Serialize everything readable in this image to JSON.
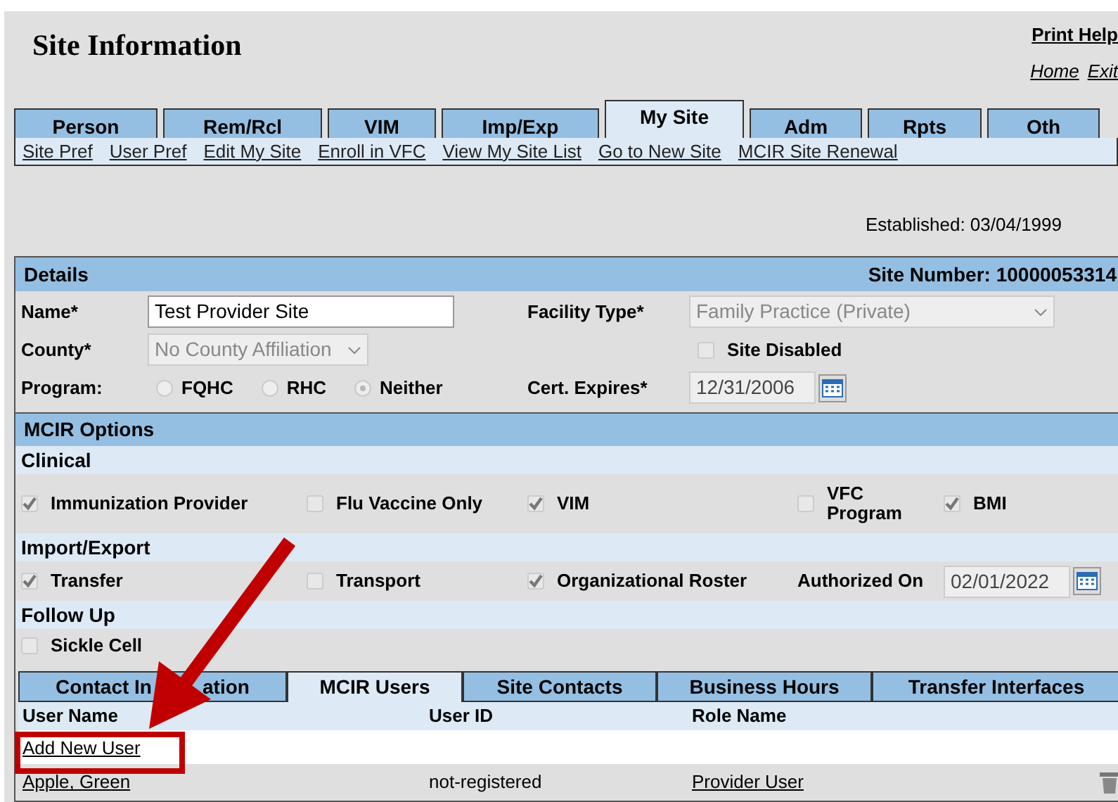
{
  "header": {
    "title": "Site Information",
    "print_help": "Print Help",
    "links": [
      "Home",
      "Exit"
    ]
  },
  "tabs": [
    {
      "label": "Person",
      "selected": false
    },
    {
      "label": "Rem/Rcl",
      "selected": false
    },
    {
      "label": "VIM",
      "selected": false
    },
    {
      "label": "Imp/Exp",
      "selected": false
    },
    {
      "label": "My Site",
      "selected": true
    },
    {
      "label": "Adm",
      "selected": false
    },
    {
      "label": "Rpts",
      "selected": false
    },
    {
      "label": "Oth",
      "selected": false
    }
  ],
  "subnav": [
    "Site Pref",
    "User Pref",
    "Edit My Site",
    "Enroll in VFC",
    "View My Site List",
    "Go to New Site",
    "MCIR Site Renewal"
  ],
  "established": "Established: 03/04/1999",
  "details": {
    "title": "Details",
    "site_number": "Site Number: 10000053314",
    "name": {
      "label": "Name*",
      "value": "Test Provider Site"
    },
    "facility_type": {
      "label": "Facility Type*",
      "value": "Family Practice (Private)",
      "disabled": true
    },
    "county": {
      "label": "County*",
      "value": "No County Affiliation",
      "disabled": true
    },
    "site_disabled": {
      "label": "Site Disabled",
      "checked": false
    },
    "program": {
      "label": "Program:",
      "options": [
        {
          "label": "FQHC",
          "selected": false
        },
        {
          "label": "RHC",
          "selected": false
        },
        {
          "label": "Neither",
          "selected": true
        }
      ]
    },
    "cert_expires": {
      "label": "Cert. Expires*",
      "value": "12/31/2006"
    }
  },
  "mcir_options": {
    "title": "MCIR Options",
    "groups": [
      {
        "title": "Clinical",
        "options": [
          {
            "label": "Immunization Provider",
            "checked": true
          },
          {
            "label": "Flu Vaccine Only",
            "checked": false
          },
          {
            "label": "VIM",
            "checked": true
          },
          {
            "label": "VFC Program",
            "checked": false
          },
          {
            "label": "BMI",
            "checked": true
          }
        ]
      },
      {
        "title": "Import/Export",
        "options": [
          {
            "label": "Transfer",
            "checked": true
          },
          {
            "label": "Transport",
            "checked": false
          },
          {
            "label": "Organizational Roster",
            "checked": true
          }
        ],
        "authorized_on": {
          "label": "Authorized On",
          "value": "02/01/2022"
        }
      },
      {
        "title": "Follow Up",
        "options": [
          {
            "label": "Sickle Cell",
            "checked": false
          }
        ]
      }
    ]
  },
  "bottom_tabs": [
    {
      "label": "Contact In",
      "label_tail": "ation",
      "selected": false
    },
    {
      "label": "MCIR Users",
      "selected": true
    },
    {
      "label": "Site Contacts",
      "selected": false
    },
    {
      "label": "Business Hours",
      "selected": false
    },
    {
      "label": "Transfer Interfaces",
      "selected": false
    }
  ],
  "users_table": {
    "columns": [
      "User Name",
      "User ID",
      "Role Name"
    ],
    "add_link": "Add New User",
    "rows": [
      {
        "user_name": "Apple, Green",
        "user_id": "not-registered",
        "role_name": "Provider User"
      }
    ]
  }
}
